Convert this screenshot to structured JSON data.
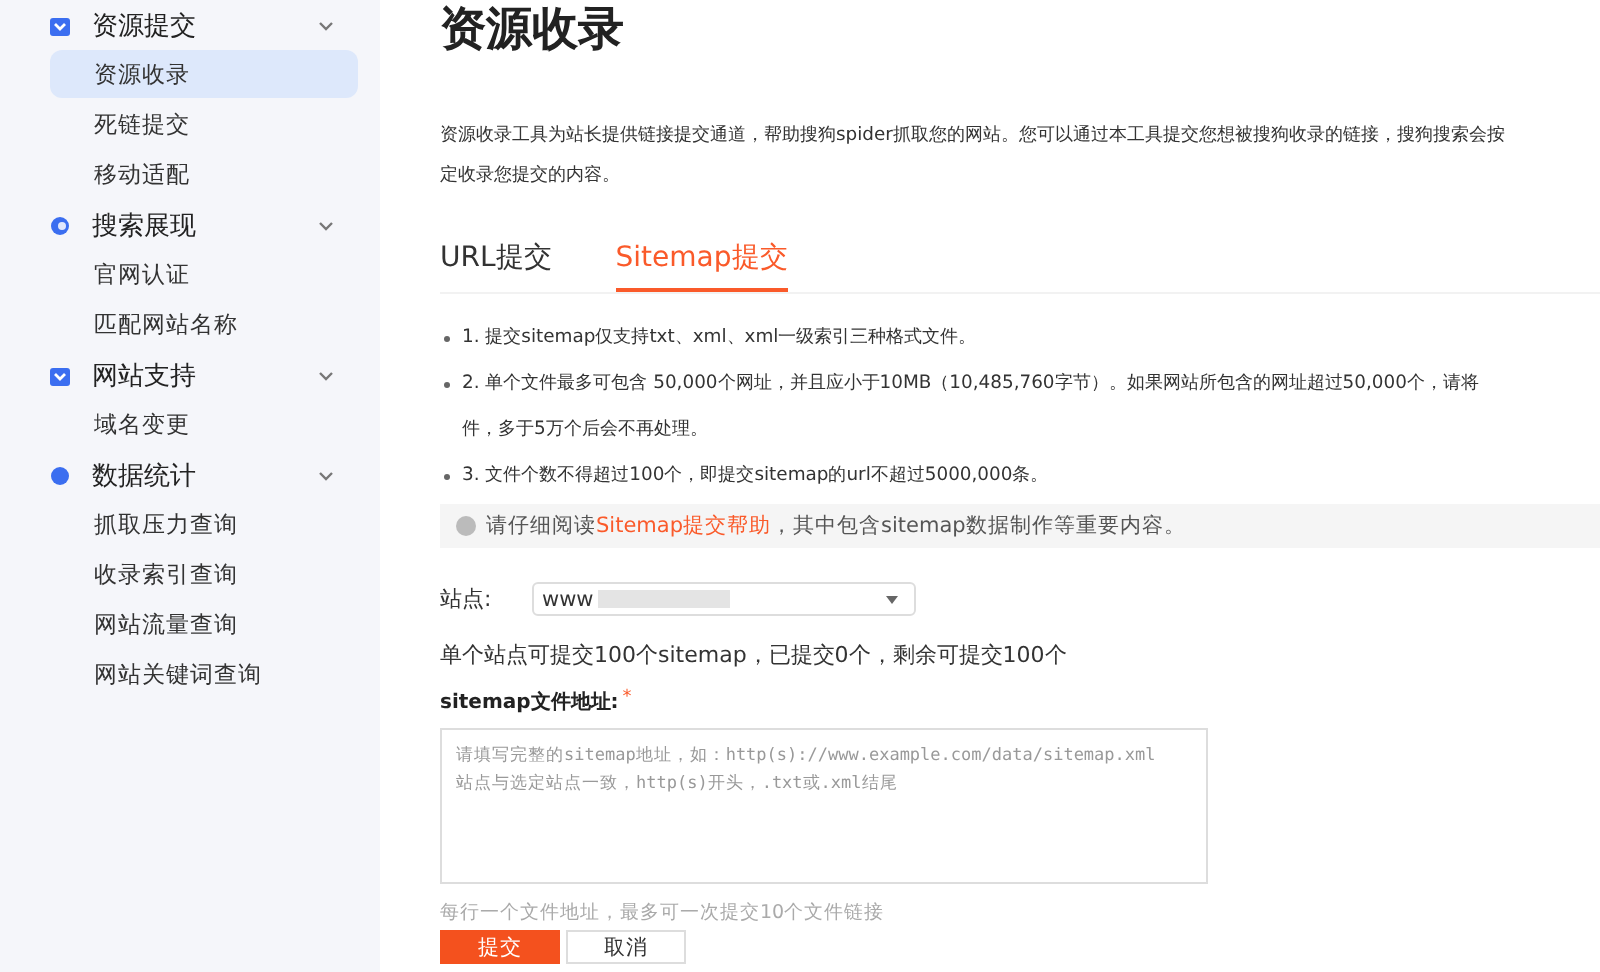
{
  "sidebar": {
    "groups": [
      {
        "title": "资源提交",
        "expanded": true,
        "items": [
          {
            "label": "资源收录",
            "selected": true
          },
          {
            "label": "死链提交",
            "selected": false
          },
          {
            "label": "移动适配",
            "selected": false
          }
        ]
      },
      {
        "title": "搜索展现",
        "expanded": true,
        "items": [
          {
            "label": "官网认证",
            "selected": false
          },
          {
            "label": "匹配网站名称",
            "selected": false
          }
        ]
      },
      {
        "title": "网站支持",
        "expanded": true,
        "items": [
          {
            "label": "域名变更",
            "selected": false
          }
        ]
      },
      {
        "title": "数据统计",
        "expanded": true,
        "items": [
          {
            "label": "抓取压力查询",
            "selected": false
          },
          {
            "label": "收录索引查询",
            "selected": false
          },
          {
            "label": "网站流量查询",
            "selected": false
          },
          {
            "label": "网站关键词查询",
            "selected": false
          }
        ]
      }
    ]
  },
  "page_title": "资源收录",
  "description_lines": [
    "资源收录工具为站长提供链接提交通道，帮助搜狗spider抓取您的网站。您可以通过本工具提交您想被搜狗收录的链接，搜狗搜索会按",
    "定收录您提交的内容。"
  ],
  "tabs": [
    {
      "label": "URL提交",
      "selected": false
    },
    {
      "label": "Sitemap提交",
      "selected": true
    }
  ],
  "rules": [
    {
      "lines": [
        "1. 提交sitemap仅支持txt、xml、xml一级索引三种格式文件。"
      ]
    },
    {
      "lines": [
        "2. 单个文件最多可包含 50,000个网址，并且应小于10MB（10,485,760字节）。如果网站所包含的网址超过50,000个，请将",
        "件，多于5万个后会不再处理。"
      ]
    },
    {
      "lines": [
        "3. 文件个数不得超过100个，即提交sitemap的url不超过5000,000条。"
      ]
    }
  ],
  "notice": {
    "before": "请仔细阅读",
    "link": "Sitemap提交帮助",
    "after": "，其中包含sitemap数据制作等重要内容。"
  },
  "site": {
    "label": "站点:",
    "value": "www",
    "redacted": true
  },
  "quota": "单个站点可提交100个sitemap，已提交0个，剩余可提交100个",
  "sitemap_field": {
    "label": "sitemap文件地址:",
    "required_mark": "*",
    "placeholder": "请填写完整的sitemap地址，如：http(s)://www.example.com/data/sitemap.xml\n站点与选定站点一致，http(s)开头，.txt或.xml结尾"
  },
  "hint": "每行一个文件地址，最多可一次提交10个文件链接",
  "buttons": [
    {
      "label": "提交",
      "kind": "primary"
    },
    {
      "label": "取消",
      "kind": "default"
    }
  ]
}
